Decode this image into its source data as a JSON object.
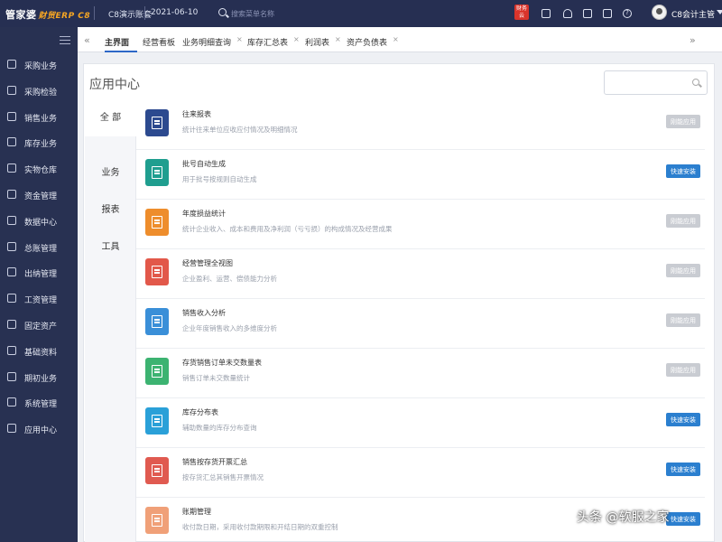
{
  "topbar": {
    "logo_main": "管家婆",
    "logo_sub": "财贸ERP C8",
    "account": "C8演示账套",
    "date": "2021-06-10",
    "search_placeholder": "搜索菜单名称",
    "badge_text": "财务云",
    "user_name": "C8会计主管"
  },
  "sidebar": {
    "items": [
      {
        "label": "采购业务",
        "icon": "cart-icon"
      },
      {
        "label": "采购检验",
        "icon": "cart-check-icon"
      },
      {
        "label": "销售业务",
        "icon": "clipboard-icon"
      },
      {
        "label": "库存业务",
        "icon": "truck-icon"
      },
      {
        "label": "实物仓库",
        "icon": "warehouse-icon"
      },
      {
        "label": "资金管理",
        "icon": "money-icon"
      },
      {
        "label": "数据中心",
        "icon": "monitor-icon"
      },
      {
        "label": "总账管理",
        "icon": "moneybag-icon"
      },
      {
        "label": "出纳管理",
        "icon": "cashier-icon"
      },
      {
        "label": "工资管理",
        "icon": "salary-icon"
      },
      {
        "label": "固定资产",
        "icon": "yen-icon"
      },
      {
        "label": "基础资料",
        "icon": "grid-icon"
      },
      {
        "label": "期初业务",
        "icon": "calendar-icon"
      },
      {
        "label": "系统管理",
        "icon": "home-icon"
      },
      {
        "label": "应用中心",
        "icon": "apps-icon"
      }
    ]
  },
  "tabs": [
    {
      "label": "主界面",
      "closable": false,
      "active": true
    },
    {
      "label": "经营看板",
      "closable": false,
      "active": false
    },
    {
      "label": "业务明细查询",
      "closable": true,
      "active": false
    },
    {
      "label": "库存汇总表",
      "closable": true,
      "active": false
    },
    {
      "label": "利润表",
      "closable": true,
      "active": false
    },
    {
      "label": "资产负债表",
      "closable": true,
      "active": false
    }
  ],
  "tab_close_glyph": "×",
  "tab_prev_glyph": "«",
  "tab_next_glyph": "»",
  "main": {
    "title": "应用中心",
    "search_placeholder": "",
    "categories": [
      {
        "label": "全 部",
        "active": true
      },
      {
        "label": "业务",
        "active": false
      },
      {
        "label": "报表",
        "active": false
      },
      {
        "label": "工具",
        "active": false
      }
    ],
    "apps": [
      {
        "name": "往来报表",
        "desc": "统计往来单位应收应付情况及明细情况",
        "button": "刚能应用",
        "state": "open",
        "color": "#2c4a8f"
      },
      {
        "name": "批号自动生成",
        "desc": "用于批号按规则自动生成",
        "button": "快速安装",
        "state": "install",
        "color": "#1f9e8f"
      },
      {
        "name": "年度损益统计",
        "desc": "统计企业收入、成本和费用及净利润（亏亏损）的构成情况及经营成果",
        "button": "刚能应用",
        "state": "open",
        "color": "#ee8d2c"
      },
      {
        "name": "经营管理全视图",
        "desc": "企业盈利、运营、偿债能力分析",
        "button": "刚能应用",
        "state": "open",
        "color": "#e2584a"
      },
      {
        "name": "销售收入分析",
        "desc": "企业年度销售收入的多维度分析",
        "button": "刚能应用",
        "state": "open",
        "color": "#3a8fd8"
      },
      {
        "name": "存货销售订单未交数量表",
        "desc": "销售订单未交数量统计",
        "button": "刚能应用",
        "state": "open",
        "color": "#3cb371"
      },
      {
        "name": "库存分布表",
        "desc": "辅助数量的库存分布查询",
        "button": "快速安装",
        "state": "install",
        "color": "#2aa0d8"
      },
      {
        "name": "销售按存货开票汇总",
        "desc": "按存货汇总其销售开票情况",
        "button": "快速安装",
        "state": "install",
        "color": "#e05a50"
      },
      {
        "name": "账期管理",
        "desc": "收付款日期，采用收付款期限和开结日期的双重控制",
        "button": "快速安装",
        "state": "install",
        "color": "#f0a078"
      }
    ]
  },
  "watermark": "头条 @软服之家"
}
